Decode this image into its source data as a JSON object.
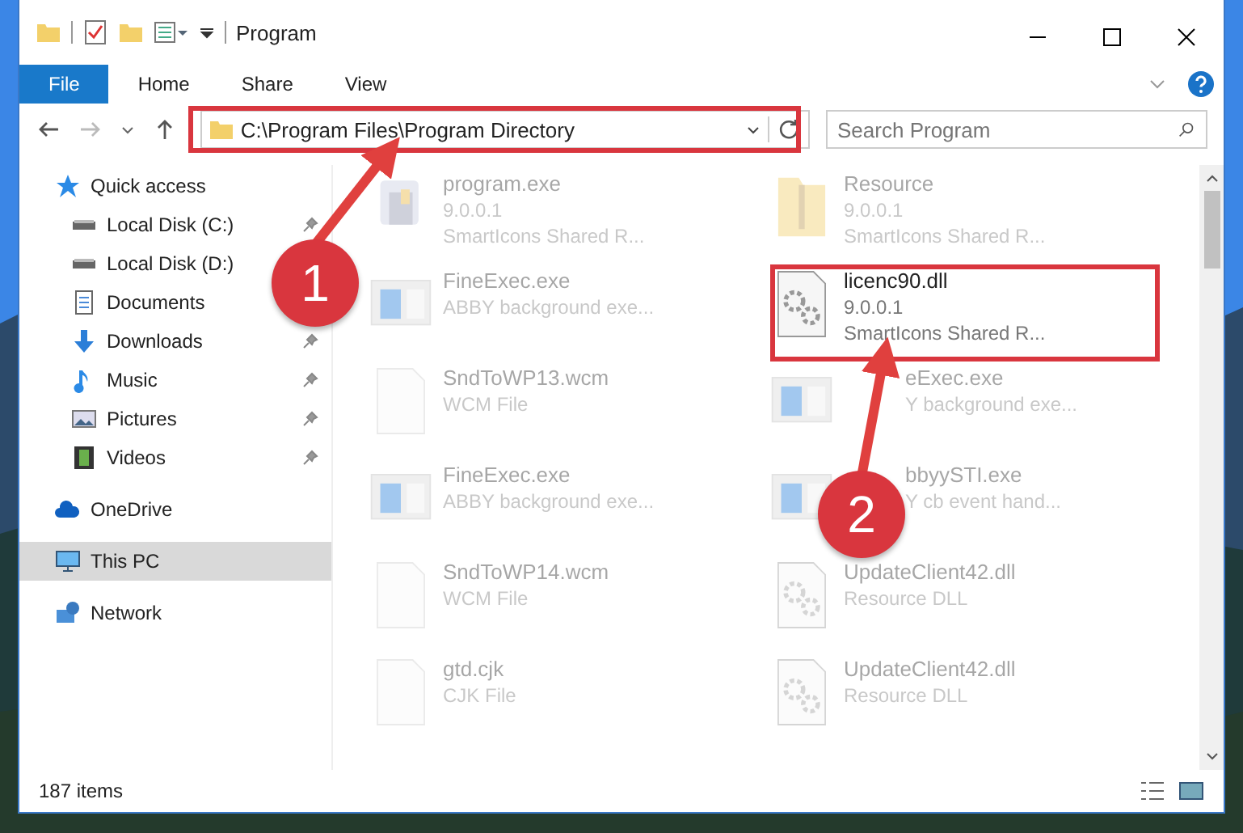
{
  "window": {
    "title": "Program"
  },
  "ribbon_tabs": [
    {
      "label": "File",
      "kind": "file",
      "selected": false
    },
    {
      "label": "Home",
      "kind": "tab",
      "selected": false
    },
    {
      "label": "Share",
      "kind": "tab",
      "selected": false
    },
    {
      "label": "View",
      "kind": "tab",
      "selected": false
    }
  ],
  "address_bar": {
    "path": "C:\\Program Files\\Program Directory"
  },
  "search": {
    "placeholder": "Search Program"
  },
  "sidebar": {
    "items": [
      {
        "label": "Quick access",
        "selected": false,
        "children": [
          {
            "label": "Local Disk (C:)",
            "pinned": true
          },
          {
            "label": "Local Disk (D:)"
          },
          {
            "label": "Documents"
          },
          {
            "label": "Downloads",
            "pinned": true
          },
          {
            "label": "Music",
            "pinned": true
          },
          {
            "label": "Pictures",
            "pinned": true
          },
          {
            "label": "Videos",
            "pinned": true
          }
        ]
      },
      {
        "label": "OneDrive",
        "selected": false
      },
      {
        "label": "This PC",
        "selected": true
      },
      {
        "label": "Network",
        "selected": false
      }
    ]
  },
  "files": [
    {
      "name": "program.exe",
      "lines": [
        "9.0.0.1",
        "SmartIcons Shared R..."
      ],
      "kind": "app",
      "faded": true
    },
    {
      "name": "Resource",
      "lines": [
        "9.0.0.1",
        "SmartIcons Shared R..."
      ],
      "kind": "folder",
      "faded": true
    },
    {
      "name": "FineExec.exe",
      "lines": [
        "ABBY background exe..."
      ],
      "kind": "window",
      "faded": true
    },
    {
      "name": "licenc90.dll",
      "lines": [
        "9.0.0.1",
        "SmartIcons Shared R..."
      ],
      "kind": "dll",
      "faded": false
    },
    {
      "name": "SndToWP13.wcm",
      "lines": [
        "WCM File"
      ],
      "kind": "file",
      "faded": true
    },
    {
      "name": "eExec.exe",
      "lines": [
        "Y background exe..."
      ],
      "kind": "window",
      "faded": true
    },
    {
      "name": "FineExec.exe",
      "lines": [
        "ABBY background exe..."
      ],
      "kind": "window",
      "faded": true
    },
    {
      "name": "bbyySTI.exe",
      "lines": [
        "Y cb event hand..."
      ],
      "kind": "window",
      "faded": true
    },
    {
      "name": "SndToWP14.wcm",
      "lines": [
        "WCM File"
      ],
      "kind": "file",
      "faded": true
    },
    {
      "name": "UpdateClient42.dll",
      "lines": [
        "Resource DLL"
      ],
      "kind": "dll",
      "faded": true
    },
    {
      "name": "gtd.cjk",
      "lines": [
        "CJK File"
      ],
      "kind": "file",
      "faded": true
    },
    {
      "name": "UpdateClient42.dll",
      "lines": [
        "Resource DLL"
      ],
      "kind": "dll",
      "faded": true
    }
  ],
  "status_bar": {
    "count": "187 items"
  },
  "annotations": [
    {
      "label": "1"
    },
    {
      "label": "2"
    }
  ]
}
